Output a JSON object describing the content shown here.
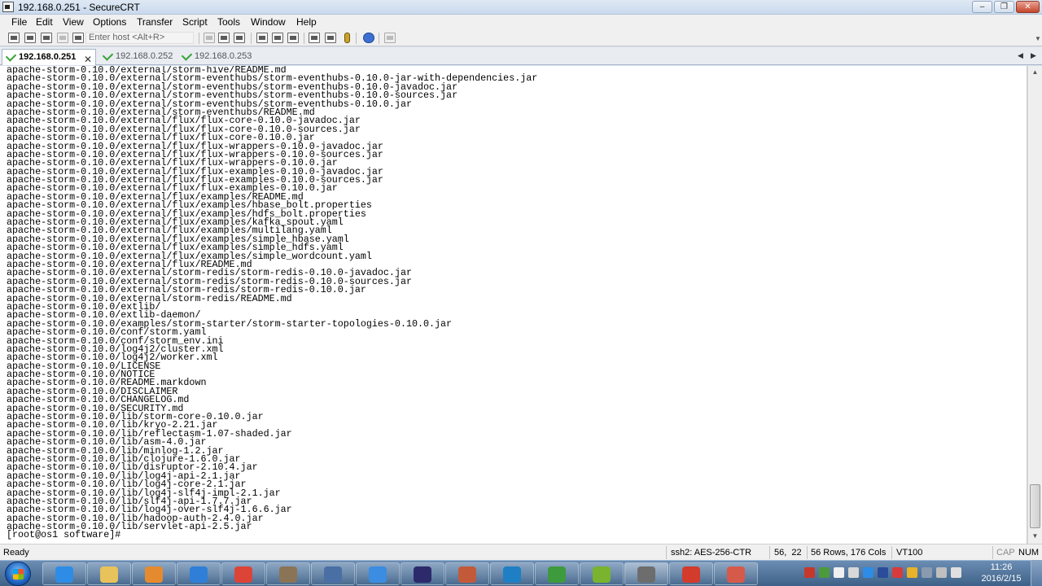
{
  "window": {
    "title": "192.168.0.251 - SecureCRT",
    "minimize": "‒",
    "maximize": "❐",
    "close": "✕"
  },
  "menu": [
    "File",
    "Edit",
    "View",
    "Options",
    "Transfer",
    "Script",
    "Tools",
    "Window",
    "Help"
  ],
  "toolbar": {
    "host_placeholder": "Enter host <Alt+R>"
  },
  "tabs": [
    {
      "label": "192.168.0.251",
      "active": true,
      "close": "✕"
    },
    {
      "label": "192.168.0.252",
      "active": false
    },
    {
      "label": "192.168.0.253",
      "active": false
    }
  ],
  "tab_scroll": {
    "left": "◀",
    "right": "▶"
  },
  "terminal": {
    "lines": [
      "apache-storm-0.10.0/external/storm-hive/README.md",
      "apache-storm-0.10.0/external/storm-eventhubs/storm-eventhubs-0.10.0-jar-with-dependencies.jar",
      "apache-storm-0.10.0/external/storm-eventhubs/storm-eventhubs-0.10.0-javadoc.jar",
      "apache-storm-0.10.0/external/storm-eventhubs/storm-eventhubs-0.10.0-sources.jar",
      "apache-storm-0.10.0/external/storm-eventhubs/storm-eventhubs-0.10.0.jar",
      "apache-storm-0.10.0/external/storm-eventhubs/README.md",
      "apache-storm-0.10.0/external/flux/flux-core-0.10.0-javadoc.jar",
      "apache-storm-0.10.0/external/flux/flux-core-0.10.0-sources.jar",
      "apache-storm-0.10.0/external/flux/flux-core-0.10.0.jar",
      "apache-storm-0.10.0/external/flux/flux-wrappers-0.10.0-javadoc.jar",
      "apache-storm-0.10.0/external/flux/flux-wrappers-0.10.0-sources.jar",
      "apache-storm-0.10.0/external/flux/flux-wrappers-0.10.0.jar",
      "apache-storm-0.10.0/external/flux/flux-examples-0.10.0-javadoc.jar",
      "apache-storm-0.10.0/external/flux/flux-examples-0.10.0-sources.jar",
      "apache-storm-0.10.0/external/flux/flux-examples-0.10.0.jar",
      "apache-storm-0.10.0/external/flux/examples/README.md",
      "apache-storm-0.10.0/external/flux/examples/hbase_bolt.properties",
      "apache-storm-0.10.0/external/flux/examples/hdfs_bolt.properties",
      "apache-storm-0.10.0/external/flux/examples/kafka_spout.yaml",
      "apache-storm-0.10.0/external/flux/examples/multilang.yaml",
      "apache-storm-0.10.0/external/flux/examples/simple_hbase.yaml",
      "apache-storm-0.10.0/external/flux/examples/simple_hdfs.yaml",
      "apache-storm-0.10.0/external/flux/examples/simple_wordcount.yaml",
      "apache-storm-0.10.0/external/flux/README.md",
      "apache-storm-0.10.0/external/storm-redis/storm-redis-0.10.0-javadoc.jar",
      "apache-storm-0.10.0/external/storm-redis/storm-redis-0.10.0-sources.jar",
      "apache-storm-0.10.0/external/storm-redis/storm-redis-0.10.0.jar",
      "apache-storm-0.10.0/external/storm-redis/README.md",
      "apache-storm-0.10.0/extlib/",
      "apache-storm-0.10.0/extlib-daemon/",
      "apache-storm-0.10.0/examples/storm-starter/storm-starter-topologies-0.10.0.jar",
      "apache-storm-0.10.0/conf/storm.yaml",
      "apache-storm-0.10.0/conf/storm_env.ini",
      "apache-storm-0.10.0/log4j2/cluster.xml",
      "apache-storm-0.10.0/log4j2/worker.xml",
      "apache-storm-0.10.0/LICENSE",
      "apache-storm-0.10.0/NOTICE",
      "apache-storm-0.10.0/README.markdown",
      "apache-storm-0.10.0/DISCLAIMER",
      "apache-storm-0.10.0/CHANGELOG.md",
      "apache-storm-0.10.0/SECURITY.md",
      "apache-storm-0.10.0/lib/storm-core-0.10.0.jar",
      "apache-storm-0.10.0/lib/kryo-2.21.jar",
      "apache-storm-0.10.0/lib/reflectasm-1.07-shaded.jar",
      "apache-storm-0.10.0/lib/asm-4.0.jar",
      "apache-storm-0.10.0/lib/minlog-1.2.jar",
      "apache-storm-0.10.0/lib/clojure-1.6.0.jar",
      "apache-storm-0.10.0/lib/disruptor-2.10.4.jar",
      "apache-storm-0.10.0/lib/log4j-api-2.1.jar",
      "apache-storm-0.10.0/lib/log4j-core-2.1.jar",
      "apache-storm-0.10.0/lib/log4j-slf4j-impl-2.1.jar",
      "apache-storm-0.10.0/lib/slf4j-api-1.7.7.jar",
      "apache-storm-0.10.0/lib/log4j-over-slf4j-1.6.6.jar",
      "apache-storm-0.10.0/lib/hadoop-auth-2.4.0.jar",
      "apache-storm-0.10.0/lib/servlet-api-2.5.jar",
      "[root@os1 software]#"
    ]
  },
  "scrollbar": {
    "up": "▲",
    "down": "▼"
  },
  "status": {
    "ready": "Ready",
    "cipher": "ssh2: AES-256-CTR",
    "cursor": "56,  22",
    "size": "56 Rows, 176 Cols",
    "emulation": "VT100",
    "caps": "CAP",
    "num": "NUM"
  },
  "taskbar": {
    "time": "11:26",
    "date": "2016/2/15",
    "apps": [
      {
        "name": "internet-explorer",
        "color": "#2d8ce6"
      },
      {
        "name": "file-explorer",
        "color": "#e8c25a"
      },
      {
        "name": "media-player",
        "color": "#e58a2e"
      },
      {
        "name": "network-share",
        "color": "#2f7fd8"
      },
      {
        "name": "chrome",
        "color": "#db4437"
      },
      {
        "name": "archive-tool",
        "color": "#8b7355"
      },
      {
        "name": "remote-desktop",
        "color": "#4a6fa5"
      },
      {
        "name": "feather-app",
        "color": "#3a8de0"
      },
      {
        "name": "eclipse",
        "color": "#2c2a6b"
      },
      {
        "name": "character-app",
        "color": "#c25a3a"
      },
      {
        "name": "virtualbox",
        "color": "#1f7fc4"
      },
      {
        "name": "presentation-tool",
        "color": "#3d9a3d"
      },
      {
        "name": "mindmap-app",
        "color": "#7ab32e"
      },
      {
        "name": "securecrt",
        "color": "#6d6d6d"
      },
      {
        "name": "xmind",
        "color": "#d33b2c"
      },
      {
        "name": "tool-app",
        "color": "#d65a4a"
      }
    ],
    "tray": [
      {
        "name": "shield-tray-icon",
        "color": "#c7382c"
      },
      {
        "name": "network-tray-icon",
        "color": "#4c9a3c"
      },
      {
        "name": "windows-tray-icon",
        "color": "#f0f0f0"
      },
      {
        "name": "keyboard-tray-icon",
        "color": "#d8d8d8"
      },
      {
        "name": "update-tray-icon",
        "color": "#2d8ce6"
      },
      {
        "name": "antivirus-tray-icon",
        "color": "#2a4c9b"
      },
      {
        "name": "bluetooth-tray-icon",
        "color": "#d83b3b"
      },
      {
        "name": "qq-tray-icon",
        "color": "#e8b32a"
      },
      {
        "name": "cloud-tray-icon",
        "color": "#8a9bb0"
      },
      {
        "name": "display-tray-icon",
        "color": "#bfbfbf"
      },
      {
        "name": "speaker-tray-icon",
        "color": "#e0e0e0"
      }
    ]
  }
}
